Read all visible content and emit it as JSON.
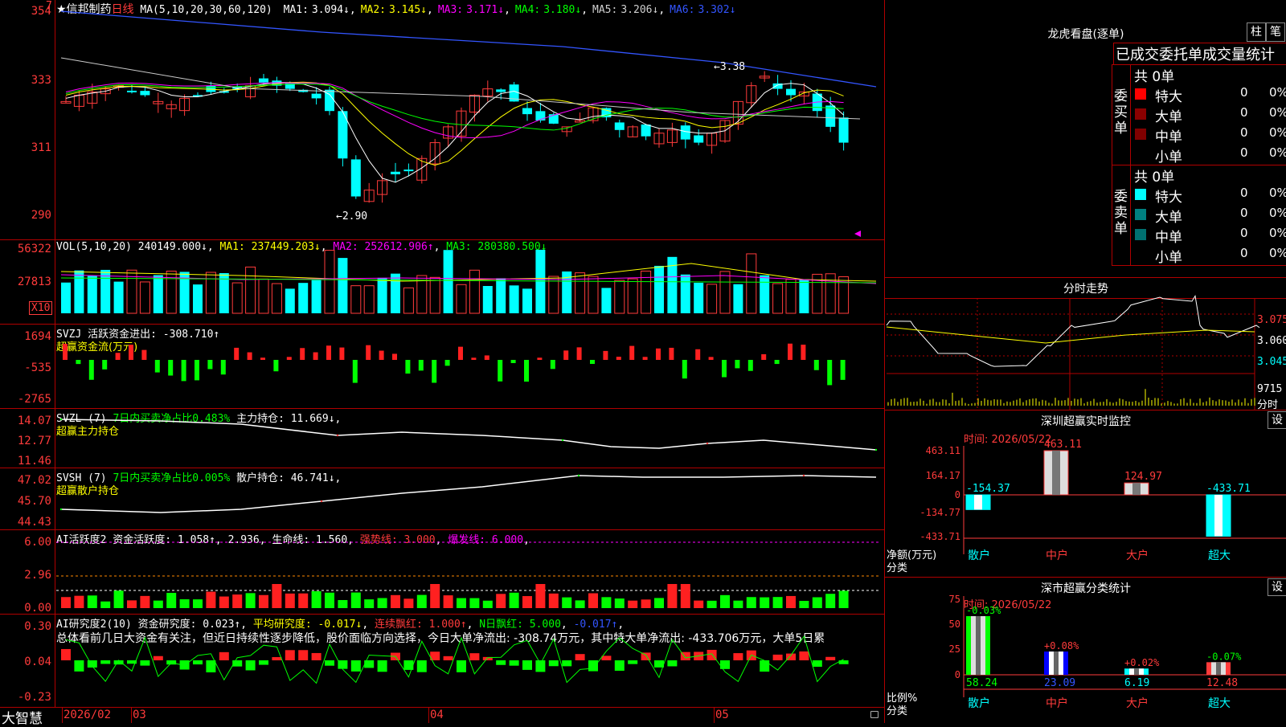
{
  "main": {
    "stock_name": "★信邦制药",
    "period": "日线",
    "ma_label": "MA(5,10,20,30,60,120)",
    "ma": [
      {
        "label": "MA1:",
        "value": "3.094↓",
        "color": "#ffffff"
      },
      {
        "label": "MA2:",
        "value": "3.145↓",
        "color": "#ffff00"
      },
      {
        "label": "MA3:",
        "value": "3.171↓",
        "color": "#ff00ff"
      },
      {
        "label": "MA4:",
        "value": "3.180↓",
        "color": "#00ff00"
      },
      {
        "label": "MA5:",
        "value": "3.206↓",
        "color": "#d0d0d0"
      },
      {
        "label": "MA6:",
        "value": "3.302↓",
        "color": "#3355ff"
      }
    ],
    "ylabels": [
      "354",
      "333",
      "311",
      "290"
    ],
    "high_mark": "3.38",
    "low_mark": "2.90",
    "corner": "7"
  },
  "vol": {
    "header": "VOL(5,10,20)",
    "value": "240149.000↓",
    "ma1": "MA1: 237449.203↓",
    "ma2": "MA2: 252612.906↑",
    "ma3": "MA3: 280380.500↓",
    "ylabels": [
      "56322",
      "27813"
    ],
    "unit": "X10"
  },
  "svzj": {
    "header": "SVZJ  活跃资金进出: -308.710↑",
    "sub": "超赢资金流(万元)",
    "ylabels": [
      "1694",
      "-535",
      "-2765"
    ]
  },
  "svzl": {
    "header_a": "SVZL (7)",
    "header_b": "7日内买卖净占比0.483%",
    "header_c": "主力持仓: 11.669↓",
    "sub": "超赢主力持仓",
    "ylabels": [
      "14.07",
      "12.77",
      "11.46"
    ]
  },
  "svsh": {
    "header_a": "SVSH (7)",
    "header_b": "7日内买卖净占比0.005%",
    "header_c": "散户持仓: 46.741↓",
    "sub": "超赢散户持仓",
    "ylabels": [
      "47.02",
      "45.70",
      "44.43"
    ]
  },
  "ai1": {
    "header_a": "AI活跃度2 资金活跃度: 1.058↑",
    "header_b": "2.936",
    "header_c": "生命线: 1.560",
    "header_d": "强势线: 3.000",
    "header_e": "爆发线: 6.000",
    "ylabels": [
      "6.00",
      "2.96",
      "0.00"
    ]
  },
  "ai2": {
    "header_a": "AI研究度2(10) 资金研究度: 0.023↑",
    "header_b": "平均研究度: -0.017↓",
    "header_c": "连续飘红: 1.000↑",
    "header_d": "N日飘红: 5.000",
    "header_e": "-0.017↑",
    "summary": "总体看前几日大资金有关注，但近日持续性逐步降低，股价面临方向选择，今日大单净流出: -308.74万元，其中特大单净流出: -433.706万元，大单5日累",
    "ylabels": [
      "0.30",
      "0.04",
      "-0.23"
    ]
  },
  "bottom": {
    "brand": "大智慧",
    "dates": [
      "2026/02",
      "03",
      "04",
      "05"
    ]
  },
  "dragon": {
    "title": "龙虎看盘(逐单)",
    "btn1": "柱",
    "btn2": "笔",
    "tabs": "已成交委托单成交量统计",
    "buy_label": "委买单",
    "sell_label": "委卖单",
    "buy_total": "共 0单",
    "sell_total": "共 0单",
    "rows": [
      "特大",
      "大单",
      "中单",
      "小单"
    ],
    "zero": "0",
    "pct": "0%"
  },
  "intraday": {
    "title": "分时走势",
    "ylabels": [
      "3.075",
      "3.060",
      "3.045"
    ],
    "vol_label": "9715",
    "time_label": "分时"
  },
  "sz_monitor": {
    "title": "深圳超赢实时监控",
    "setbtn": "设",
    "time": "时间: 2026/05/22",
    "ylabels": [
      "463.11",
      "164.17",
      "0",
      "-134.77",
      "-433.71"
    ],
    "values": [
      "-154.37",
      "463.11",
      "124.97",
      "-433.71"
    ],
    "net_label": "净额(万元)",
    "cat_label": "分类",
    "cats": [
      "散户",
      "中户",
      "大户",
      "超大"
    ]
  },
  "sz_stats": {
    "title": "深市超赢分类统计",
    "setbtn": "设",
    "time": "时间: 2026/05/22",
    "ylabels": [
      "75",
      "50",
      "25",
      "0"
    ],
    "changes": [
      "-0.03%",
      "+0.08%",
      "+0.02%",
      "-0.07%"
    ],
    "values": [
      "58.24",
      "23.09",
      "6.19",
      "12.48"
    ],
    "ratio_label": "比例%",
    "cat_label": "分类",
    "cats": [
      "散户",
      "中户",
      "大户",
      "超大"
    ]
  }
}
